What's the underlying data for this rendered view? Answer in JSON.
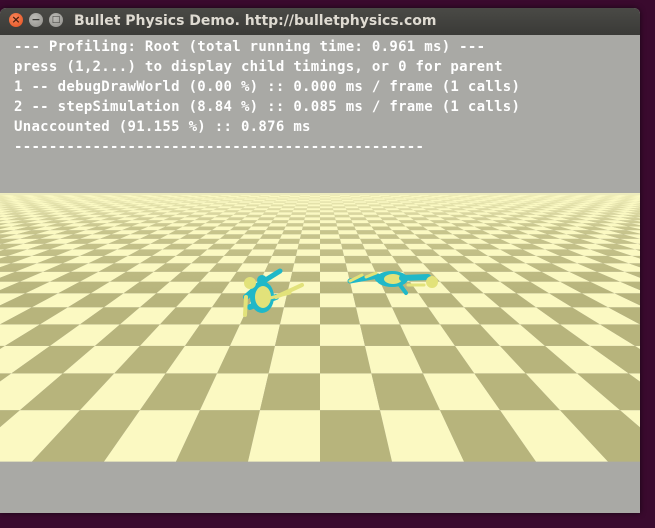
{
  "window": {
    "title": "Bullet Physics Demo. http://bulletphysics.com",
    "close_glyph": "×",
    "minimize_glyph": "−",
    "maximize_glyph": "□"
  },
  "profiling": {
    "header": "--- Profiling: Root (total running time: 0.961 ms) ---",
    "help": "press (1,2...) to display child timings, or 0 for parent",
    "line1": "1 -- debugDrawWorld (0.00 %) :: 0.000 ms / frame (1 calls)",
    "line2": "2 -- stepSimulation (8.84 %) :: 0.085 ms / frame (1 calls)",
    "unaccounted": "Unaccounted (91.155 %) :: 0.876 ms",
    "separator": "-----------------------------------------------"
  },
  "colors": {
    "floor_light": "#fbf9c2",
    "floor_dark": "#b7b47c",
    "ragdoll_cyan": "#20b8c8",
    "ragdoll_yellow": "#e2e27a"
  }
}
